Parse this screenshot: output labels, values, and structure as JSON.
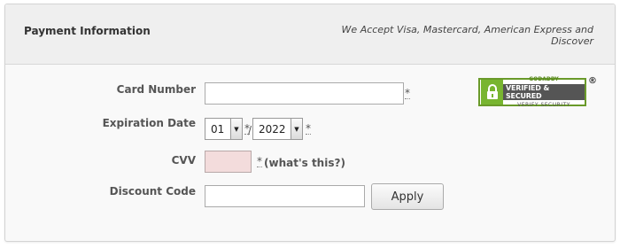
{
  "header": {
    "title": "Payment Information",
    "accept_text": "We Accept Visa, Mastercard, American Express and Discover"
  },
  "form": {
    "card_number": {
      "label": "Card Number",
      "value": "",
      "required_mark": "*"
    },
    "expiration": {
      "label": "Expiration Date",
      "month": "01",
      "year": "2022",
      "required_mark": "*",
      "separator": "/"
    },
    "cvv": {
      "label": "CVV",
      "value": "",
      "required_mark": "*",
      "help_link": "(what's this?)"
    },
    "discount": {
      "label": "Discount Code",
      "value": "",
      "apply_label": "Apply"
    }
  },
  "badge": {
    "line1": "GODADDY",
    "line2": "VERIFIED & SECURED",
    "line3": "VERIFY SECURITY",
    "registered": "®"
  },
  "colors": {
    "cvv_bg": "#f3dcdc",
    "badge_green": "#78b530",
    "header_bg": "#efefef"
  }
}
